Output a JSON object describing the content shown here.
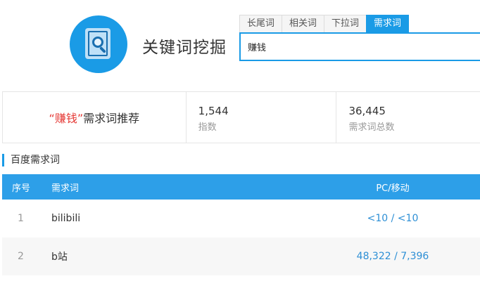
{
  "app": {
    "title": "关键词挖掘"
  },
  "tabs": [
    {
      "label": "长尾词",
      "active": false
    },
    {
      "label": "相关词",
      "active": false
    },
    {
      "label": "下拉词",
      "active": false
    },
    {
      "label": "需求词",
      "active": true
    }
  ],
  "search": {
    "value": "赚钱"
  },
  "summary": {
    "keyword": "“赚钱”",
    "title": "需求词推荐",
    "stats": [
      {
        "value": "1,544",
        "label": "指数"
      },
      {
        "value": "36,445",
        "label": "需求词总数"
      }
    ]
  },
  "section": {
    "title": "百度需求词"
  },
  "table": {
    "headers": {
      "index": "序号",
      "word": "需求词",
      "pc_mobile": "PC/移动"
    },
    "rows": [
      {
        "index": "1",
        "word": "bilibili",
        "pc_mobile": "<10 / <10"
      },
      {
        "index": "2",
        "word": "b站",
        "pc_mobile": "48,322 / 7,396"
      }
    ]
  },
  "colors": {
    "accent": "#1a9be6",
    "keyword": "#e53935"
  },
  "icons": {
    "logo": "document-search-icon"
  }
}
